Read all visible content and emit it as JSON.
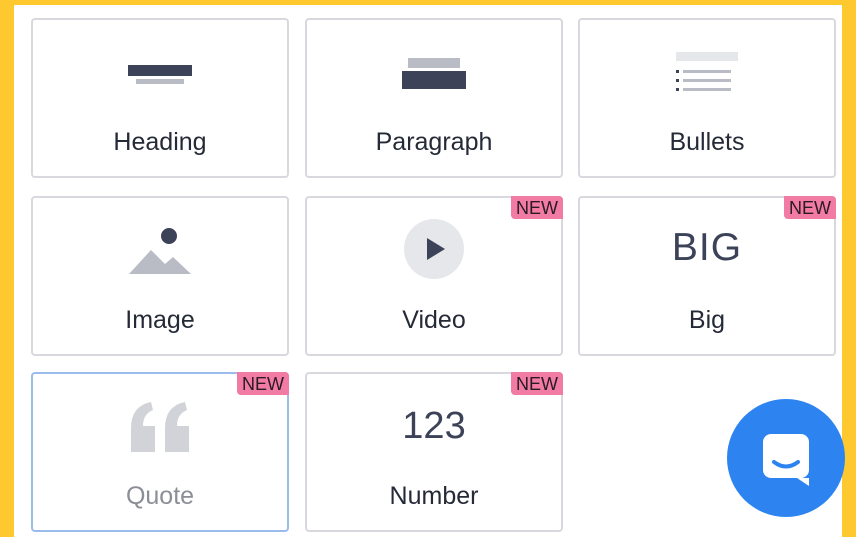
{
  "colors": {
    "frame": "#FDC92F",
    "badge": "#F27BA3",
    "chat": "#2D84F1",
    "selected_border": "#9dbcee"
  },
  "tiles": [
    {
      "label": "Heading",
      "icon": "heading-icon"
    },
    {
      "label": "Paragraph",
      "icon": "paragraph-icon"
    },
    {
      "label": "Bullets",
      "icon": "bullets-icon"
    },
    {
      "label": "Image",
      "icon": "image-icon"
    },
    {
      "label": "Video",
      "icon": "play-icon",
      "badge": "NEW"
    },
    {
      "label": "Big",
      "icon": "big-text-icon",
      "icon_text": "BIG",
      "badge": "NEW"
    },
    {
      "label": "Quote",
      "icon": "quote-icon",
      "badge": "NEW",
      "selected": true
    },
    {
      "label": "Number",
      "icon": "number-icon",
      "icon_text": "123",
      "badge": "NEW"
    }
  ],
  "chat": {
    "icon": "chat-icon"
  }
}
